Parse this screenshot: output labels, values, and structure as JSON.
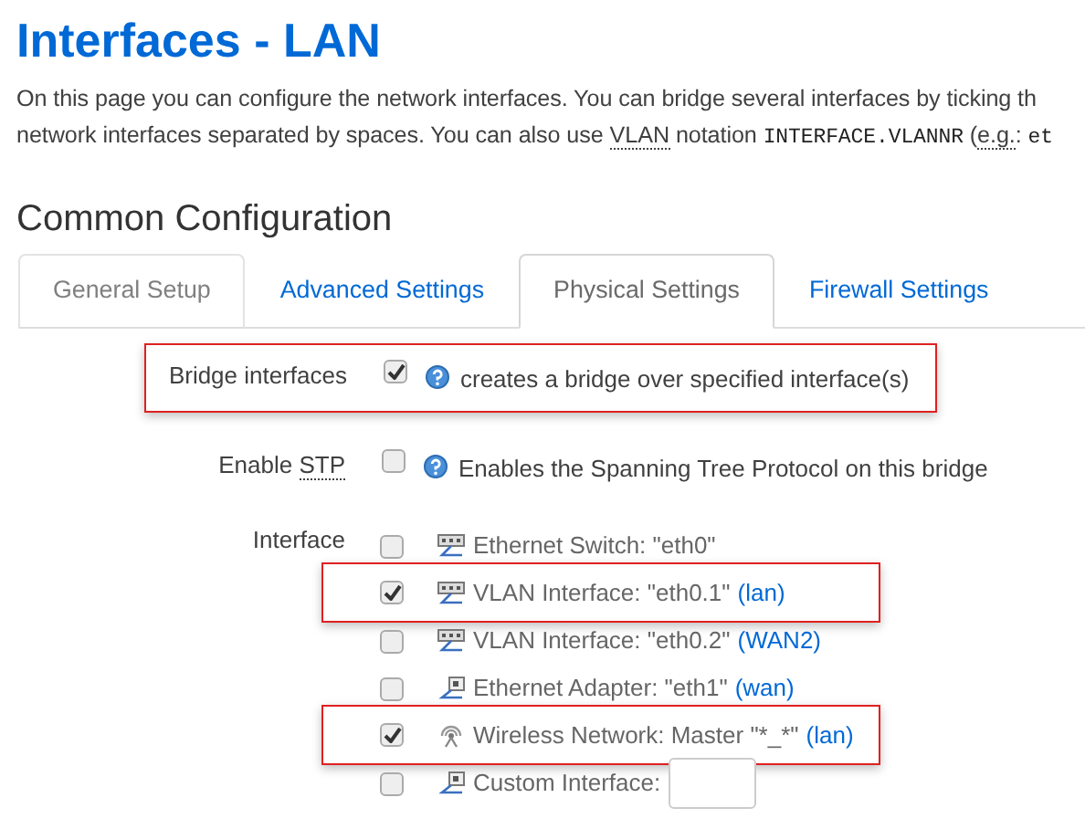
{
  "title": "Interfaces - LAN",
  "description": [
    [
      {
        "kind": "text",
        "text": "On this page you can configure the network interfaces. You can bridge several interfaces by ticking th"
      }
    ],
    [
      {
        "kind": "text",
        "text": "network interfaces separated by spaces. You can also use "
      },
      {
        "kind": "abbr",
        "text": "VLAN"
      },
      {
        "kind": "text",
        "text": " notation "
      },
      {
        "kind": "code",
        "text": "INTERFACE.VLANNR"
      },
      {
        "kind": "text",
        "text": " ("
      },
      {
        "kind": "abbr",
        "text": "e.g."
      },
      {
        "kind": "text",
        "text": ": "
      },
      {
        "kind": "code",
        "text": "et"
      }
    ]
  ],
  "section_title": "Common Configuration",
  "tabs": [
    {
      "label": "General Setup",
      "selected": false,
      "hovered": true
    },
    {
      "label": "Advanced Settings",
      "selected": false,
      "hovered": false
    },
    {
      "label": "Physical Settings",
      "selected": true,
      "hovered": false
    },
    {
      "label": "Firewall Settings",
      "selected": false,
      "hovered": false
    }
  ],
  "rows": [
    {
      "kind": "checkbox",
      "label": [
        {
          "kind": "text",
          "text": "Bridge interfaces"
        }
      ],
      "checked": true,
      "highlighted": true,
      "help": "creates a bridge over specified interface(s)"
    },
    {
      "kind": "checkbox",
      "label": [
        {
          "kind": "text",
          "text": "Enable "
        },
        {
          "kind": "abbr",
          "text": "STP"
        }
      ],
      "checked": false,
      "highlighted": false,
      "help": "Enables the Spanning Tree Protocol on this bridge"
    },
    {
      "kind": "interfaces",
      "label": [
        {
          "kind": "text",
          "text": "Interface"
        }
      ],
      "options": [
        {
          "kind": "switch",
          "text": "Ethernet Switch: \"eth0\"",
          "checked": false,
          "highlighted": false
        },
        {
          "kind": "switch",
          "text": "VLAN Interface: \"eth0.1\"",
          "network": "(lan)",
          "checked": true,
          "highlighted": true
        },
        {
          "kind": "switch",
          "text": "VLAN Interface: \"eth0.2\"",
          "network": "(WAN2)",
          "checked": false,
          "highlighted": false
        },
        {
          "kind": "adapter",
          "text": "Ethernet Adapter: \"eth1\"",
          "network": "(wan)",
          "checked": false,
          "highlighted": false
        },
        {
          "kind": "wireless",
          "text": "Wireless Network: Master \"*_*\"",
          "network": "(lan)",
          "checked": true,
          "highlighted": true
        },
        {
          "kind": "custom",
          "text": "Custom Interface:",
          "checked": false,
          "highlighted": false
        }
      ]
    }
  ]
}
